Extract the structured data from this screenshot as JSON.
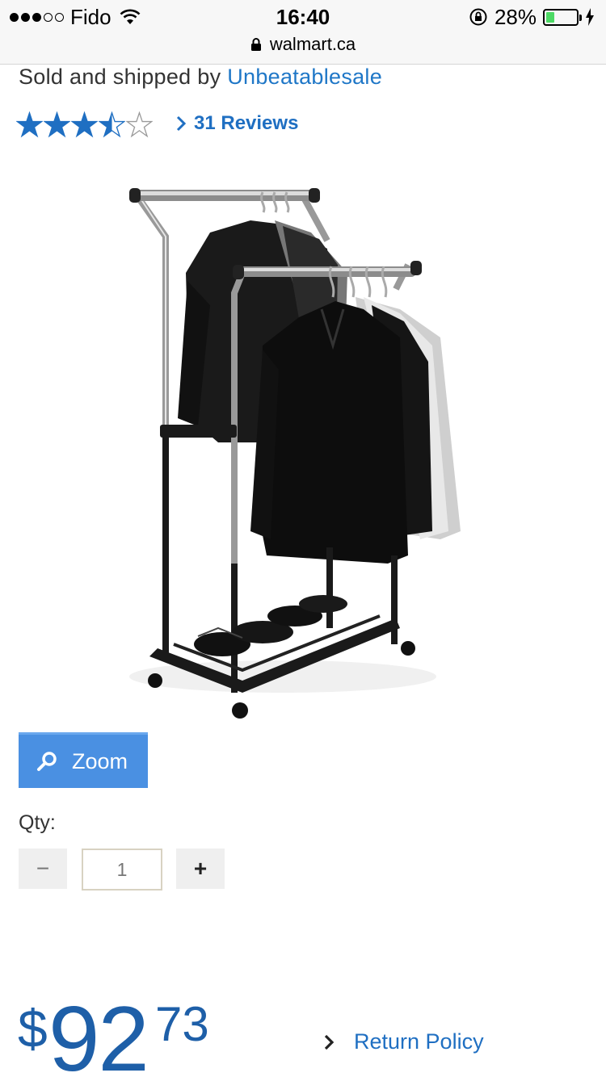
{
  "status_bar": {
    "carrier": "Fido",
    "time": "16:40",
    "battery_percent": "28%",
    "battery_level": 0.28,
    "url": "walmart.ca"
  },
  "seller": {
    "prefix": "Sold and shipped by",
    "name": "Unbeatablesale"
  },
  "rating": {
    "stars": 3.5,
    "out_of": 5,
    "reviews_label": "31 Reviews"
  },
  "zoom": {
    "label": "Zoom"
  },
  "quantity": {
    "label": "Qty:",
    "value": "1",
    "minus": "−",
    "plus": "+"
  },
  "price": {
    "currency": "$",
    "dollars": "92",
    "cents": "73"
  },
  "return_policy": {
    "label": "Return Policy"
  },
  "colors": {
    "link": "#1f77c7",
    "star": "#1f6fc2",
    "zoom_button": "#4a90e2",
    "price": "#1e5fa8"
  }
}
